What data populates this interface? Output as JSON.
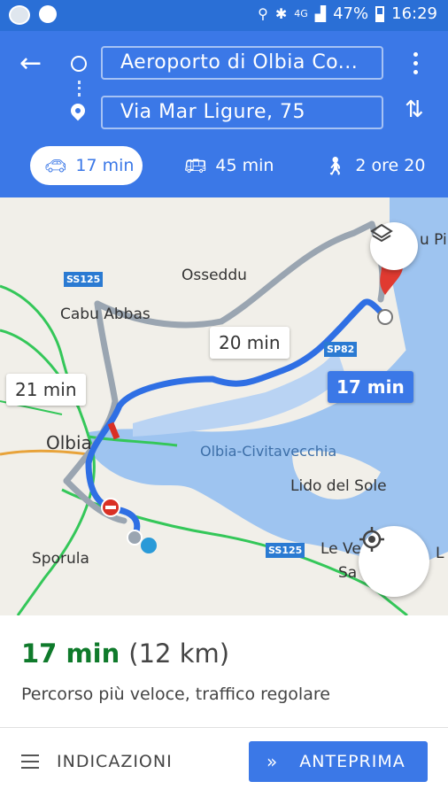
{
  "status_bar": {
    "battery": "47%",
    "time": "16:29",
    "network": "4G"
  },
  "header": {
    "origin": "Aeroporto di Olbia Co...",
    "destination": "Via Mar Ligure, 75"
  },
  "modes": {
    "car": "17 min",
    "transit": "45 min",
    "walk": "2 ore 20"
  },
  "map": {
    "labels": {
      "osseddu": "Osseddu",
      "cabu_abbas": "Cabu Abbas",
      "olbia": "Olbia",
      "sporula": "Sporula",
      "lido": "Lido del Sole",
      "strait": "Olbia-Civitavecchia",
      "le_ve": "Le Ve",
      "sa": "Sa",
      "pi": "u Pi",
      "l": "L"
    },
    "road_badges": {
      "ss125_top": "SS125",
      "sp82": "SP82",
      "ss125_bottom": "SS125"
    },
    "bubbles": {
      "alt1": "20 min",
      "alt2": "21 min",
      "selected": "17 min"
    }
  },
  "summary": {
    "time": "17 min",
    "distance": "(12 km)",
    "description": "Percorso più veloce, traffico regolare"
  },
  "actions": {
    "directions": "INDICAZIONI",
    "preview": "ANTEPRIMA"
  }
}
